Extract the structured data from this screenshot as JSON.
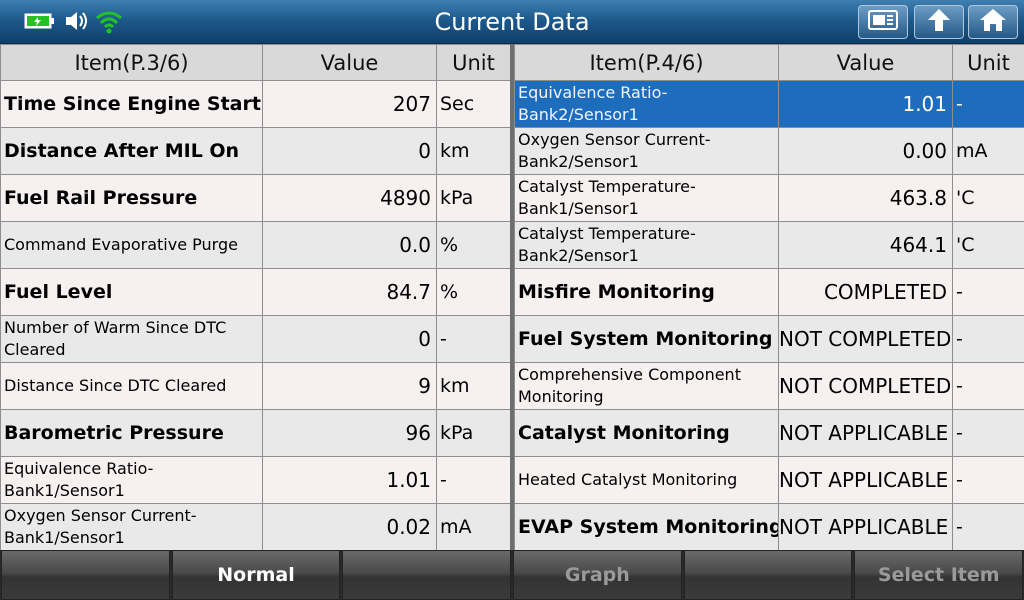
{
  "header": {
    "title": "Current Data"
  },
  "left_table": {
    "columns": [
      "Item(P.3/6)",
      "Value",
      "Unit"
    ],
    "rows": [
      {
        "item": "Time Since Engine Start",
        "value": "207",
        "unit": "Sec"
      },
      {
        "item": "Distance After MIL On",
        "value": "0",
        "unit": "km"
      },
      {
        "item": "Fuel Rail Pressure",
        "value": "4890",
        "unit": "kPa"
      },
      {
        "item": "Command Evaporative Purge",
        "value": "0.0",
        "unit": "%"
      },
      {
        "item": "Fuel Level",
        "value": "84.7",
        "unit": "%"
      },
      {
        "item": "Number of Warm Since DTC Cleared",
        "value": "0",
        "unit": "-"
      },
      {
        "item": "Distance Since DTC Cleared",
        "value": "9",
        "unit": "km"
      },
      {
        "item": "Barometric Pressure",
        "value": "96",
        "unit": "kPa"
      },
      {
        "item": "Equivalence Ratio-Bank1/Sensor1",
        "value": "1.01",
        "unit": "-"
      },
      {
        "item": "Oxygen Sensor Current-Bank1/Sensor1",
        "value": "0.02",
        "unit": "mA"
      }
    ]
  },
  "right_table": {
    "columns": [
      "Item(P.4/6)",
      "Value",
      "Unit"
    ],
    "rows": [
      {
        "item": "Equivalence Ratio-Bank2/Sensor1",
        "value": "1.01",
        "unit": "-"
      },
      {
        "item": "Oxygen Sensor Current-Bank2/Sensor1",
        "value": "0.00",
        "unit": "mA"
      },
      {
        "item": "Catalyst Temperature-Bank1/Sensor1",
        "value": "463.8",
        "unit": "'C"
      },
      {
        "item": "Catalyst Temperature-Bank2/Sensor1",
        "value": "464.1",
        "unit": "'C"
      },
      {
        "item": "Misfire Monitoring",
        "value": "COMPLETED",
        "unit": "-"
      },
      {
        "item": "Fuel System Monitoring",
        "value": "NOT COMPLETED",
        "unit": "-"
      },
      {
        "item": "Comprehensive Component Monitoring",
        "value": "NOT COMPLETED",
        "unit": "-"
      },
      {
        "item": "Catalyst Monitoring",
        "value": "NOT APPLICABLE",
        "unit": "-"
      },
      {
        "item": "Heated Catalyst Monitoring",
        "value": "NOT APPLICABLE",
        "unit": "-"
      },
      {
        "item": "EVAP System Monitoring",
        "value": "NOT APPLICABLE",
        "unit": "-"
      }
    ]
  },
  "bottom_bar": {
    "buttons": [
      "",
      "Normal",
      "",
      "Graph",
      "",
      "Select Item"
    ]
  },
  "colors": {
    "title_bar": "#1e5a8c",
    "selected_row": "#1e6dbd",
    "battery": "#22c322",
    "wifi": "#22c322"
  },
  "icons": {
    "status": [
      "battery-icon",
      "speaker-icon",
      "wifi-icon"
    ],
    "toolbar": [
      "screenshot-icon",
      "back-arrow-icon",
      "home-icon"
    ]
  }
}
